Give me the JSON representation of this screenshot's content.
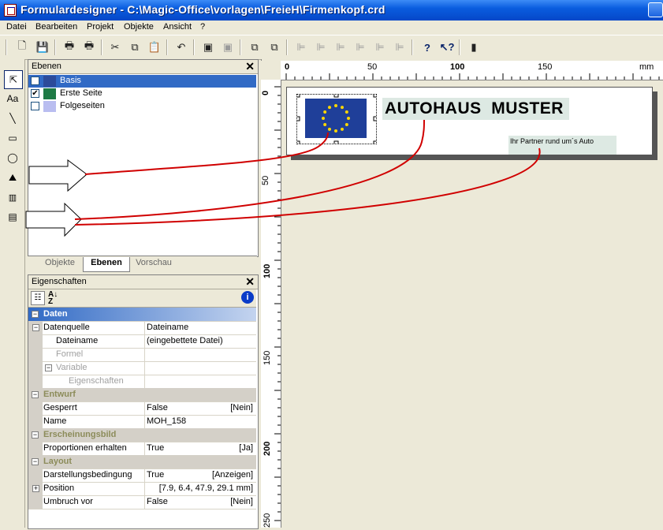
{
  "window": {
    "title": "Formulardesigner - C:\\Magic-Office\\vorlagen\\FreieH\\Firmenkopf.crd"
  },
  "menu": [
    "Datei",
    "Bearbeiten",
    "Projekt",
    "Objekte",
    "Ansicht",
    "?"
  ],
  "toolbar_icons": [
    "new-icon",
    "save-icon",
    "print-icon",
    "print-preview-icon",
    "cut-icon",
    "copy-icon",
    "paste-icon",
    "undo-icon",
    "group-icon",
    "ungroup-icon",
    "layers-front-icon",
    "layers-back-icon",
    "align-left-icon",
    "align-center-icon",
    "align-right-icon",
    "distribute-icon",
    "help-icon",
    "context-help-icon",
    "exit-icon"
  ],
  "palette_tools": [
    "select-tool-icon",
    "text-tool-icon",
    "line-tool-icon",
    "rectangle-tool-icon",
    "ellipse-tool-icon",
    "image-tool-icon",
    "barcode-tool-icon",
    "formatted-text-tool-icon"
  ],
  "layers_panel": {
    "title": "Ebenen",
    "layers": [
      {
        "name": "Basis",
        "checked": false,
        "color": "#2c4b9a",
        "selected": true
      },
      {
        "name": "Erste Seite",
        "checked": true,
        "color": "#1e7a45",
        "selected": false
      },
      {
        "name": "Folgeseiten",
        "checked": false,
        "color": "#b9bdf0",
        "selected": false
      }
    ]
  },
  "tabs": [
    "Objekte",
    "Ebenen",
    "Vorschau"
  ],
  "active_tab": "Ebenen",
  "properties_panel": {
    "title": "Eigenschaften",
    "rows": [
      {
        "type": "cat",
        "name": "Daten",
        "value": "",
        "extra": ""
      },
      {
        "type": "row",
        "name": "Datenquelle",
        "value": "Dateiname",
        "extra": "",
        "level": 0,
        "toggle": "−"
      },
      {
        "type": "row",
        "name": "Dateiname",
        "value": "(eingebettete Datei)",
        "extra": "",
        "level": 1
      },
      {
        "type": "row",
        "name": "Formel",
        "value": "",
        "extra": "",
        "level": 1,
        "gray": true
      },
      {
        "type": "row",
        "name": "Variable",
        "value": "",
        "extra": "",
        "level": 1,
        "gray": true,
        "toggle": "−"
      },
      {
        "type": "row",
        "name": "Eigenschaften",
        "value": "",
        "extra": "",
        "level": 2,
        "gray": true
      },
      {
        "type": "cat",
        "name": "Entwurf",
        "value": "",
        "extra": ""
      },
      {
        "type": "row",
        "name": "Gesperrt",
        "value": "False",
        "extra": "[Nein]",
        "level": 0
      },
      {
        "type": "row",
        "name": "Name",
        "value": "MOH_158",
        "extra": "",
        "level": 0
      },
      {
        "type": "cat",
        "name": "Erscheinungsbild",
        "value": "",
        "extra": ""
      },
      {
        "type": "row",
        "name": "Proportionen erhalten",
        "value": "True",
        "extra": "[Ja]",
        "level": 0
      },
      {
        "type": "cat",
        "name": "Layout",
        "value": "",
        "extra": ""
      },
      {
        "type": "row",
        "name": "Darstellungsbedingung",
        "value": "True",
        "extra": "[Anzeigen]",
        "level": 0
      },
      {
        "type": "row",
        "name": "Position",
        "value": "",
        "extra": "[7.9, 6.4, 47.9, 29.1 mm]",
        "level": 0,
        "toggle": "+"
      },
      {
        "type": "row",
        "name": "Umbruch vor",
        "value": "False",
        "extra": "[Nein]",
        "level": 0
      }
    ]
  },
  "ruler": {
    "h_labels": [
      "0",
      "50",
      "100",
      "150",
      "mm"
    ],
    "v_labels": [
      "0",
      "50",
      "100",
      "150",
      "200",
      "250"
    ]
  },
  "document": {
    "headline": "AUTOHAUS  MUSTER",
    "tagline": "Ihr Partner rund um´s Auto"
  },
  "colors": {
    "accent": "#316ac5",
    "eu_blue": "#1f3f99",
    "annotation": "#d00000",
    "highlight_bg": "#dde9e3"
  }
}
